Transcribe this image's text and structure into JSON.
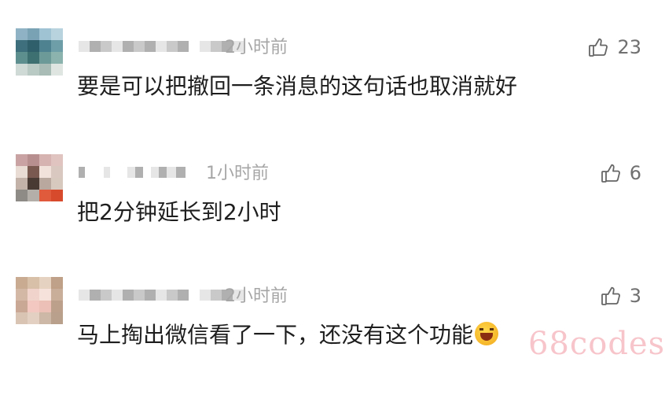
{
  "comments": [
    {
      "time": "2小时前",
      "likes": "23",
      "text": "要是可以把撤回一条消息的这句话也取消就好",
      "has_emoji": false,
      "avatar_colors": [
        "#8fb3c4",
        "#7aa2b5",
        "#9fc3d3",
        "#b8d3de",
        "#3d6f7c",
        "#2f5f6a",
        "#4f8290",
        "#6e9ea8",
        "#5e8f8f",
        "#3d7070",
        "#6c9a98",
        "#8cb3ae",
        "#cfd9d6",
        "#b9c9c4",
        "#a9bcb6",
        "#dfe6e2"
      ]
    },
    {
      "time": "1小时前",
      "likes": "6",
      "text": "把2分钟延长到2小时",
      "has_emoji": false,
      "avatar_colors": [
        "#c9a3a3",
        "#b88f8f",
        "#d6b3b0",
        "#e0c4c0",
        "#e8dcd4",
        "#7a5a50",
        "#f1e3dc",
        "#d9c8c0",
        "#c2b2a8",
        "#4a3a34",
        "#b9a89e",
        "#d8c9bf",
        "#8e8a86",
        "#b4afa9",
        "#e05a3c",
        "#d84a2c"
      ]
    },
    {
      "time": "2小时前",
      "likes": "3",
      "text": "马上掏出微信看了一下，还没有这个功能",
      "has_emoji": true,
      "avatar_colors": [
        "#c9ab92",
        "#d8bfa8",
        "#e6d2c0",
        "#bfa088",
        "#d4b8a6",
        "#f0d4cc",
        "#f6e2da",
        "#c9ae9a",
        "#caa896",
        "#f2c8c0",
        "#ecc0b6",
        "#bda08c",
        "#d9c4b4",
        "#e3d0c2",
        "#cdb7a6",
        "#b8a08c"
      ]
    }
  ],
  "watermark": "68codes"
}
